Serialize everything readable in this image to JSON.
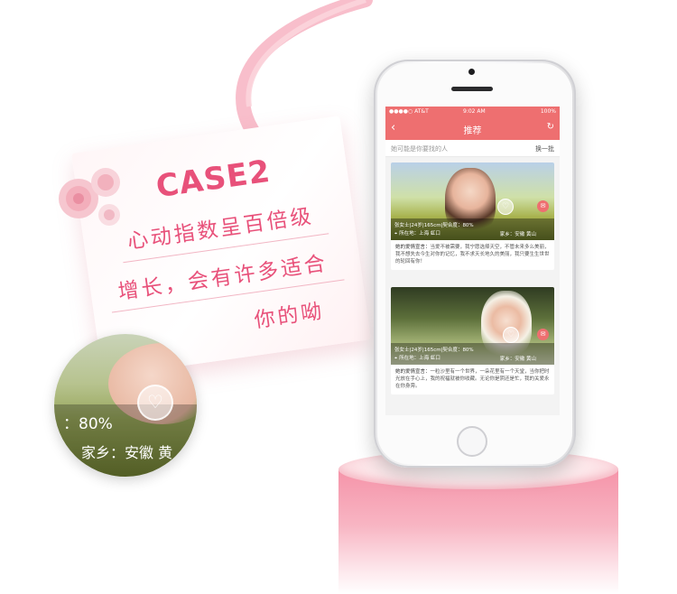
{
  "promo": {
    "title": "CASE2",
    "line1": "心动指数呈百倍级",
    "line2": "增长，会有许多适合",
    "line3": "你的呦"
  },
  "zoom": {
    "match": "：80%",
    "hometown": "家乡：安徽 黄"
  },
  "status_bar": {
    "carrier": "●●●●○ AT&T",
    "time": "9:02 AM",
    "battery": "100%"
  },
  "nav": {
    "back_icon": "chevron-left-icon",
    "title": "推荐",
    "refresh_icon": "refresh-icon"
  },
  "hint": {
    "text": "她可能是你要找的人",
    "refresh": "换一批"
  },
  "profiles": [
    {
      "info_line1": "张女士|24岁|165cm|契合度：80%",
      "location": "所在地：上海 虹口",
      "hometown": "家乡：安徽 黄山",
      "bio_label": "她的爱情宣言：",
      "bio": "当爱不被需要，我宁愿选择天空，不管未来多么美丽，我不想失去今生对你的记忆，我不求天长地久的美丽，我只要生生世世的轮回有你！"
    },
    {
      "info_line1": "张女士|24岁|165cm|契合度：80%",
      "location": "所在地：上海 虹口",
      "hometown": "家乡：安徽 黄山",
      "bio_label": "她的爱情宣言：",
      "bio": "一粒沙里有一个世界，一朵花里有一个天堂，当你把时光放在手心上，我的祝福就被你收藏。无论你是阴还是忙，我的关爱永在你身旁。"
    }
  ],
  "colors": {
    "accent": "#ee6f70",
    "promo_text": "#e8517a"
  }
}
